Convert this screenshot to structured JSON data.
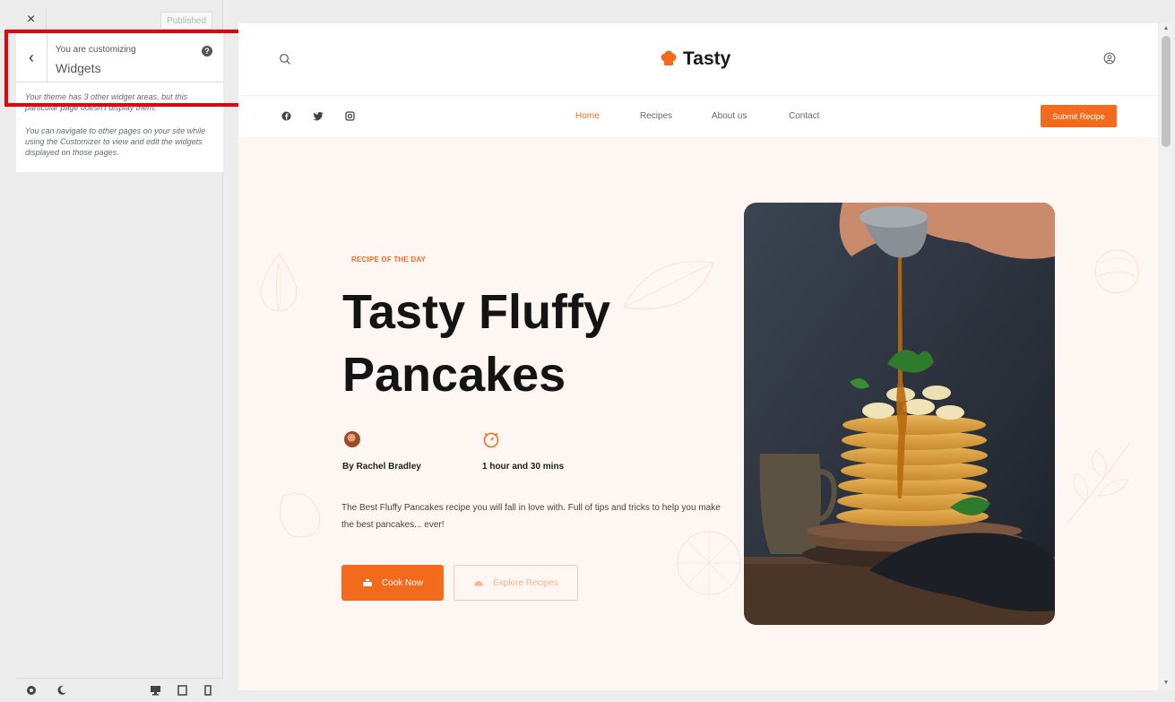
{
  "customizer": {
    "close_glyph": "×",
    "publish_label": "Published",
    "back_glyph": "‹",
    "customizing_label": "You are customizing",
    "section_title": "Widgets",
    "help_glyph": "?",
    "note_1": "Your theme has 3 other widget areas, but this particular page doesn't display them.",
    "note_2": "You can navigate to other pages on your site while using the Customizer to view and edit the widgets displayed on those pages.",
    "footer_icons": [
      "settings-icon",
      "dark-mode-icon",
      "desktop-preview-icon",
      "tablet-preview-icon",
      "mobile-preview-icon"
    ]
  },
  "site": {
    "logo_text": "Tasty",
    "nav": {
      "home": "Home",
      "recipes": "Recipes",
      "about": "About us",
      "contact": "Contact"
    },
    "submit_label": "Submit Recipe",
    "social_icons": [
      "facebook-icon",
      "twitter-icon",
      "instagram-icon"
    ]
  },
  "hero": {
    "eyebrow": "RECIPE OF THE DAY",
    "title": "Tasty Fluffy Pancakes",
    "author": "By Rachel Bradley",
    "time": "1 hour and 30 mins",
    "description": "The Best Fluffy Pancakes recipe you will fall in love with. Full of tips and tricks to help you make the best pancakes... ever!",
    "cook_label": "Cook Now",
    "explore_label": "Explore Recipes"
  },
  "colors": {
    "accent": "#f26b1d",
    "hero_bg": "#fef6f3",
    "highlight": "#e8000b"
  }
}
